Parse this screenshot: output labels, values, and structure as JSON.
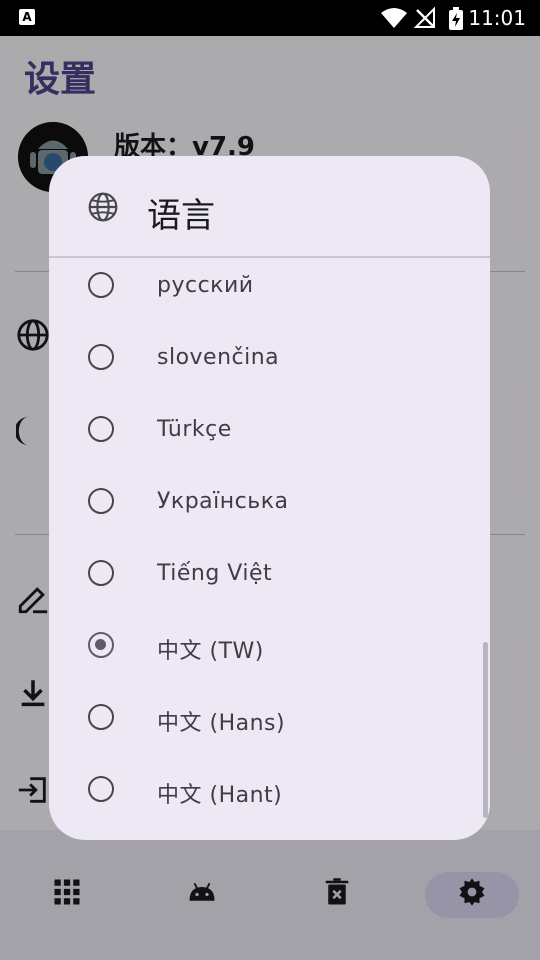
{
  "status_bar": {
    "time": "11:01",
    "app_notification_letter": "A",
    "icons": [
      "wifi-icon",
      "no-signal-icon",
      "battery-charging-icon"
    ]
  },
  "background_screen": {
    "title": "设置",
    "version_label": "版本：v7.9",
    "icons": [
      "globe-icon",
      "moon-icon",
      "edit-icon",
      "download-icon",
      "login-icon"
    ]
  },
  "bottom_nav": {
    "items": [
      "apps-icon",
      "android-icon",
      "delete-icon",
      "settings-icon"
    ],
    "active": "settings-icon"
  },
  "dialog": {
    "title": "语言",
    "icon": "globe-icon",
    "options": [
      {
        "label": "русский",
        "checked": false
      },
      {
        "label": "slovenčina",
        "checked": false
      },
      {
        "label": "Türkçe",
        "checked": false
      },
      {
        "label": "Українська",
        "checked": false
      },
      {
        "label": "Tiếng Việt",
        "checked": false
      },
      {
        "label": "中文 (TW)",
        "checked": true
      },
      {
        "label": "中文 (Hans)",
        "checked": false
      },
      {
        "label": "中文 (Hant)",
        "checked": false
      }
    ]
  },
  "colors": {
    "accent": "#4d4590",
    "dialog_bg": "#ede8f3",
    "nav_bg": "#f1eff8",
    "nav_active": "#dedbf5"
  }
}
